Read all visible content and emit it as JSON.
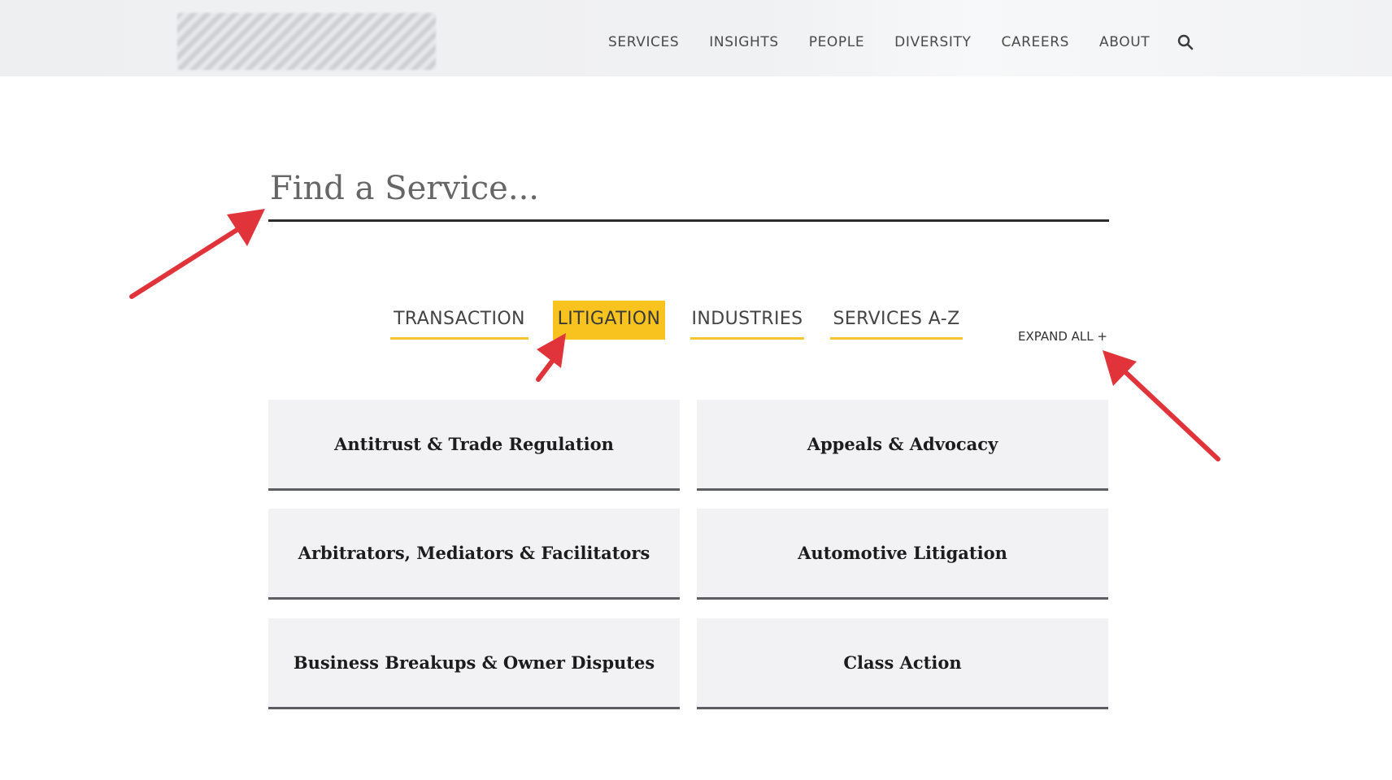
{
  "nav": {
    "items": [
      "SERVICES",
      "INSIGHTS",
      "PEOPLE",
      "DIVERSITY",
      "CAREERS",
      "ABOUT"
    ],
    "search_icon": "search-icon"
  },
  "search": {
    "placeholder": "Find a Service..."
  },
  "tabs": [
    {
      "label": "TRANSACTION",
      "active": false
    },
    {
      "label": "LITIGATION",
      "active": true
    },
    {
      "label": "INDUSTRIES",
      "active": false
    },
    {
      "label": "SERVICES A-Z",
      "active": false
    }
  ],
  "expand_all": "EXPAND ALL +",
  "services": [
    "Antitrust & Trade Regulation",
    "Appeals & Advocacy",
    "Arbitrators, Mediators & Facilitators",
    "Automotive Litigation",
    "Business Breakups & Owner Disputes",
    "Class Action"
  ],
  "colors": {
    "accent": "#f8c31f",
    "annotation_arrow": "#e0343a"
  }
}
